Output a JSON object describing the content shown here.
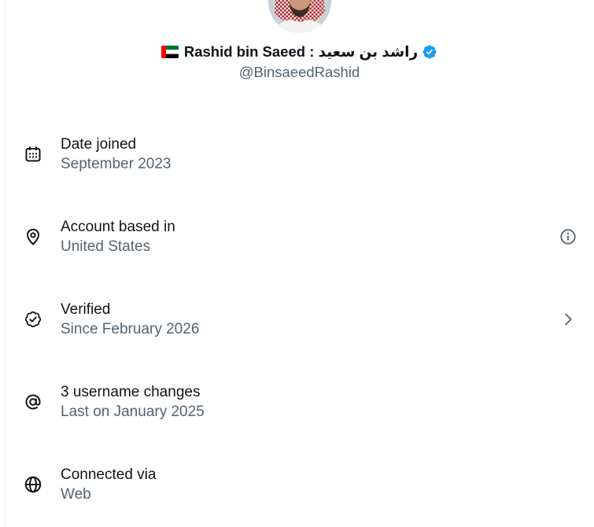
{
  "profile": {
    "flag_icon": "uae-flag-icon",
    "display_name": "Rashid bin Saeed : راشد بن سعيد",
    "verified_icon": "verified-badge-icon",
    "handle": "@BinsaeedRashid"
  },
  "rows": [
    {
      "icon": "calendar-icon",
      "label": "Date joined",
      "value": "September 2023"
    },
    {
      "icon": "location-pin-icon",
      "label": "Account based in",
      "value": "United States",
      "action_icon": "info-icon"
    },
    {
      "icon": "verified-outline-icon",
      "label": "Verified",
      "value": "Since February 2026",
      "action_icon": "chevron-right-icon"
    },
    {
      "icon": "at-sign-icon",
      "label": "3 username changes",
      "value": "Last on January 2025"
    },
    {
      "icon": "globe-icon",
      "label": "Connected via",
      "value": "Web"
    }
  ],
  "colors": {
    "text_primary": "#0f1419",
    "text_secondary": "#536471",
    "verified_blue": "#1d9bf0",
    "divider": "#eff3f4"
  }
}
